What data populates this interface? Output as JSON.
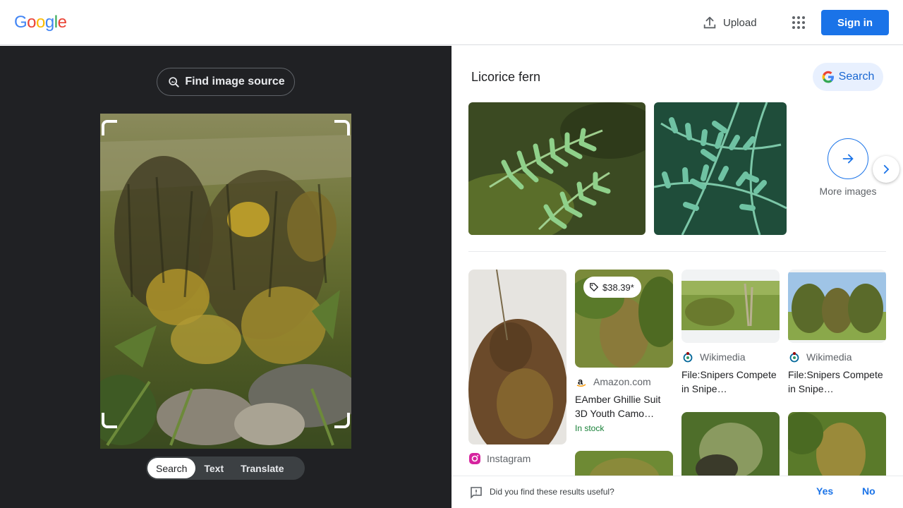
{
  "header": {
    "logo_letters": [
      "G",
      "o",
      "o",
      "g",
      "l",
      "e"
    ],
    "upload_label": "Upload",
    "signin_label": "Sign in",
    "colors": {
      "blue": "#4285f4",
      "red": "#ea4335",
      "yellow": "#fbbc05",
      "green": "#34a853"
    }
  },
  "left": {
    "find_source_label": "Find image source",
    "tabs": [
      {
        "label": "Search",
        "active": true
      },
      {
        "label": "Text",
        "active": false
      },
      {
        "label": "Translate",
        "active": false
      }
    ]
  },
  "entity": {
    "title": "Licorice fern",
    "search_label": "Search",
    "more_images_label": "More images"
  },
  "results": [
    {
      "source": "Instagram"
    },
    {
      "price": "$38.39*",
      "source": "Amazon.com",
      "title": "EAmber Ghillie Suit 3D Youth Camo…",
      "stock": "In stock"
    },
    {
      "source": "Wikimedia",
      "title": "File:Snipers Compete in Snipe…"
    },
    {
      "source": "Wikimedia",
      "title": "File:Snipers Compete in Snipe…"
    }
  ],
  "feedback": {
    "question": "Did you find these results useful?",
    "yes": "Yes",
    "no": "No"
  }
}
